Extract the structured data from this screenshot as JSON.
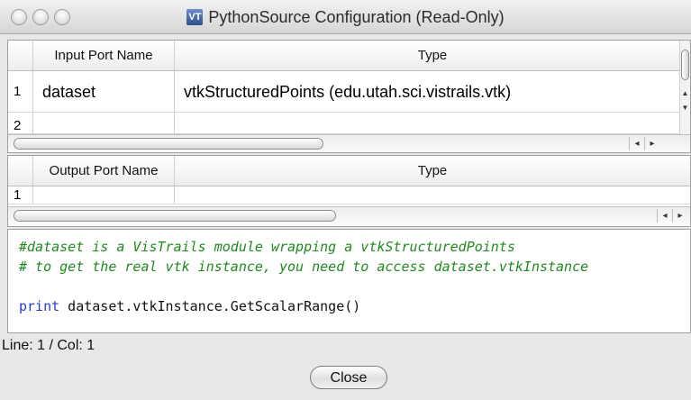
{
  "window": {
    "title": "PythonSource Configuration (Read-Only)",
    "app_icon_text": "VT"
  },
  "input_ports": {
    "headers": {
      "name": "Input Port Name",
      "type": "Type"
    },
    "rows": [
      {
        "num": "1",
        "name": "dataset",
        "type": "vtkStructuredPoints (edu.utah.sci.vistrails.vtk)"
      },
      {
        "num": "2",
        "name": "",
        "type": ""
      }
    ],
    "scroll_arrows": [
      "◂",
      "▸"
    ]
  },
  "output_ports": {
    "headers": {
      "name": "Output Port Name",
      "type": "Type"
    },
    "rows": [
      {
        "num": "1",
        "name": "",
        "type": ""
      }
    ],
    "scroll_arrows": [
      "◂",
      "▸"
    ]
  },
  "code": {
    "line1": "#dataset is a VisTrails module wrapping a vtkStructuredPoints",
    "line2": "# to get the real vtk instance, you need to access dataset.vtkInstance",
    "line4_keyword": "print",
    "line4_rest": " dataset.vtkInstance.GetScalarRange()"
  },
  "status": {
    "text": "Line: 1 / Col: 1"
  },
  "buttons": {
    "close_label": "Close"
  },
  "colors": {
    "comment": "#1f8a1f",
    "keyword": "#2a3bd1"
  }
}
